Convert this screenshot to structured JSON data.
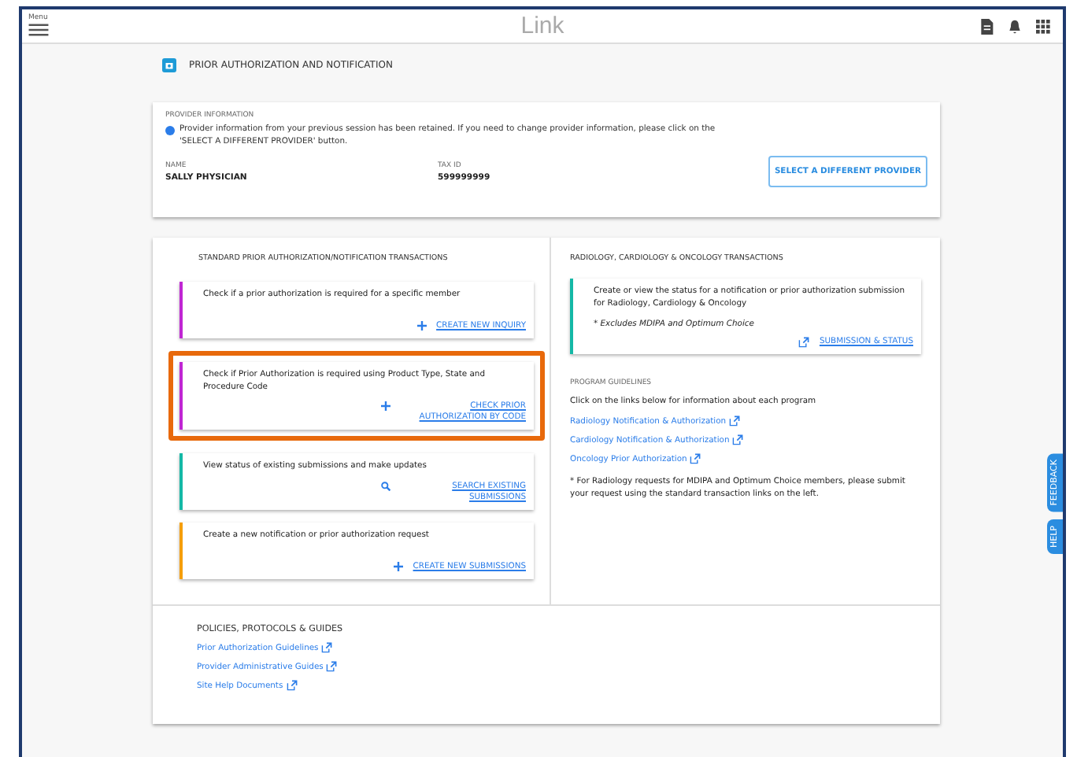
{
  "header": {
    "menu_label": "Menu",
    "logo": "Link"
  },
  "page_title": "PRIOR AUTHORIZATION AND NOTIFICATION",
  "provider": {
    "heading": "PROVIDER INFORMATION",
    "notice": "Provider information from your previous session has been retained. If you need to change provider information, please click on the 'SELECT A DIFFERENT PROVIDER' button.",
    "name_label": "NAME",
    "name": "SALLY PHYSICIAN",
    "tax_label": "TAX ID",
    "tax_id": "599999999",
    "button": "SELECT A DIFFERENT PROVIDER"
  },
  "standard": {
    "heading": "STANDARD PRIOR AUTHORIZATION/NOTIFICATION TRANSACTIONS",
    "cards": [
      {
        "text": "Check if a prior authorization is required for a specific member",
        "link": "CREATE NEW INQUIRY",
        "kind": "plus",
        "color": "#c026d3",
        "highlighted": false
      },
      {
        "text": "Check if Prior Authorization is required using Product Type, State and Procedure Code",
        "link": "CHECK PRIOR AUTHORIZATION BY CODE",
        "kind": "plus",
        "color": "#c026d3",
        "highlighted": true
      },
      {
        "text": "View status of existing submissions and make updates",
        "link": "SEARCH EXISTING SUBMISSIONS",
        "kind": "search",
        "color": "#14b8a6",
        "highlighted": false
      },
      {
        "text": "Create a new notification or prior authorization request",
        "link": "CREATE NEW SUBMISSIONS",
        "kind": "plus",
        "color": "#f59e0b",
        "highlighted": false
      }
    ]
  },
  "radiology": {
    "heading": "RADIOLOGY, CARDIOLOGY & ONCOLOGY TRANSACTIONS",
    "card": {
      "text": "Create or view the status for a notification or prior authorization submission for Radiology, Cardiology & Oncology",
      "note": "* Excludes MDIPA and Optimum Choice",
      "link": "SUBMISSION & STATUS",
      "color": "#14b8a6"
    },
    "guidelines_heading": "PROGRAM GUIDELINES",
    "guidelines_intro": "Click on the links below for information about each program",
    "links": [
      "Radiology Notification & Authorization",
      "Cardiology Notification & Authorization",
      "Oncology Prior Authorization"
    ],
    "footnote": "* For Radiology requests for MDIPA and Optimum Choice members, please submit your request using the standard transaction links on the left."
  },
  "policies": {
    "heading": "POLICIES, PROTOCOLS & GUIDES",
    "links": [
      "Prior Authorization Guidelines",
      "Provider Administrative Guides",
      "Site Help Documents"
    ]
  },
  "side_tabs": [
    "FEEDBACK",
    "HELP"
  ]
}
